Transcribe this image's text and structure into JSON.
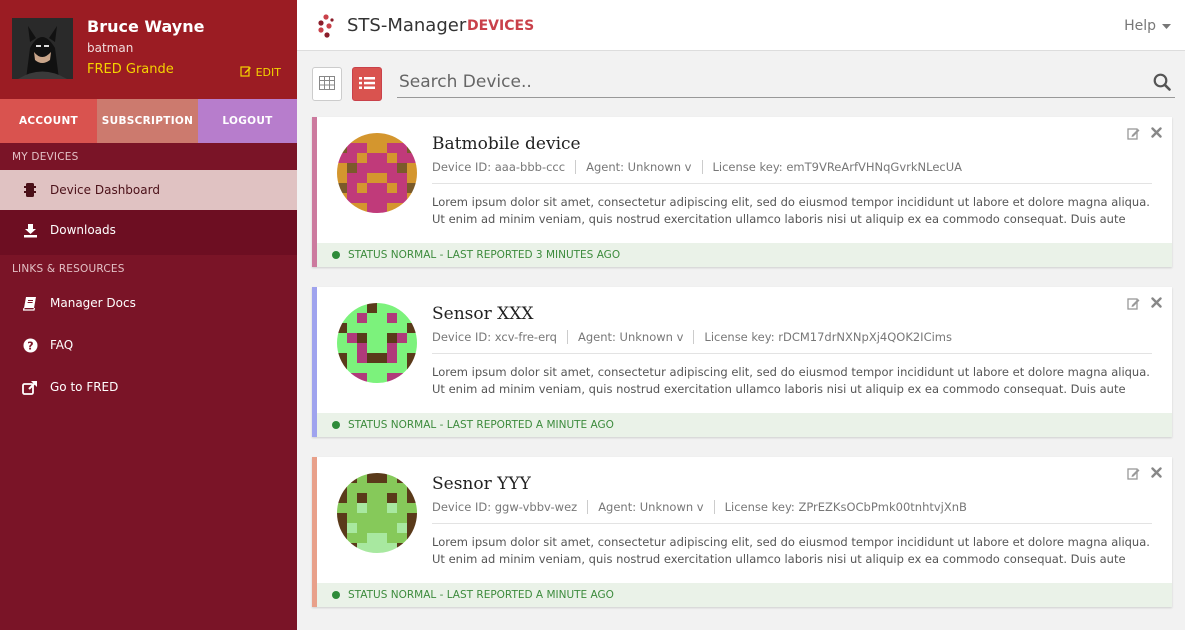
{
  "profile": {
    "name": "Bruce Wayne",
    "username": "batman",
    "org": "FRED Grande",
    "edit_label": "EDIT"
  },
  "tabs": {
    "account": "ACCOUNT",
    "subscription": "SUBSCRIPTION",
    "logout": "LOGOUT"
  },
  "sidebar": {
    "my_devices_header": "MY DEVICES",
    "device_dashboard": "Device Dashboard",
    "downloads": "Downloads",
    "links_header": "LINKS & RESOURCES",
    "manager_docs": "Manager Docs",
    "faq": "FAQ",
    "go_to_fred": "Go to FRED"
  },
  "topbar": {
    "app_title": "STS-Manager",
    "section": "DEVICES",
    "help": "Help"
  },
  "search": {
    "placeholder": "Search Device.."
  },
  "devices": [
    {
      "name": "Batmobile device",
      "device_id": "Device ID: aaa-bbb-ccc",
      "agent": "Agent: Unknown v",
      "license": "License key: emT9VReArfVHNqGvrkNLecUA",
      "description": "Lorem ipsum dolor sit amet, consectetur adipiscing elit, sed do eiusmod tempor incididunt ut labore et dolore magna aliqua. Ut enim ad minim veniam, quis nostrud exercitation ullamco laboris nisi ut aliquip ex ea commodo consequat. Duis aute irure dolor in",
      "status": "STATUS NORMAL - LAST REPORTED 3 MINUTES AGO",
      "accent": "#cc7a9e"
    },
    {
      "name": "Sensor XXX",
      "device_id": "Device ID: xcv-fre-erq",
      "agent": "Agent: Unknown v",
      "license": "License key: rDCM17drNXNpXj4QOK2ICims",
      "description": "Lorem ipsum dolor sit amet, consectetur adipiscing elit, sed do eiusmod tempor incididunt ut labore et dolore magna aliqua. Ut enim ad minim veniam, quis nostrud exercitation ullamco laboris nisi ut aliquip ex ea commodo consequat. Duis aute irure dolor in",
      "status": "STATUS NORMAL - LAST REPORTED A MINUTE AGO",
      "accent": "#9fa3ee"
    },
    {
      "name": "Sesnor YYY",
      "device_id": "Device ID: ggw-vbbv-wez",
      "agent": "Agent: Unknown v",
      "license": "License key: ZPrEZKsOCbPmk00tnhtvjXnB",
      "description": "Lorem ipsum dolor sit amet, consectetur adipiscing elit, sed do eiusmod tempor incididunt ut labore et dolore magna aliqua. Ut enim ad minim veniam, quis nostrud exercitation ullamco laboris nisi ut aliquip ex ea commodo consequat. Duis aute irure dolor in",
      "status": "STATUS NORMAL - LAST REPORTED A MINUTE AGO",
      "accent": "#e8a08a"
    }
  ],
  "colors": {
    "sidebar_bg": "#6d0e22",
    "profile_bg": "#9b1c23",
    "brand_red": "#c9414a",
    "status_green": "#3c8b3c",
    "org_yellow": "#f5d400"
  }
}
